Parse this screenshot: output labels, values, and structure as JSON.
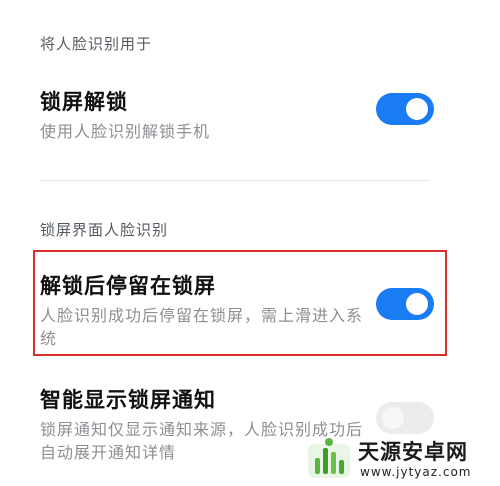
{
  "sections": {
    "face_unlock_use": "将人脸识别用于",
    "lockscreen_face": "锁屏界面人脸识别"
  },
  "rows": [
    {
      "title": "锁屏解锁",
      "subtitle": "使用人脸识别解锁手机",
      "toggle": "on"
    },
    {
      "title": "解锁后停留在锁屏",
      "subtitle": "人脸识别成功后停留在锁屏，需上滑进入系统",
      "toggle": "on"
    },
    {
      "title": "智能显示锁屏通知",
      "subtitle": "锁屏通知仅显示通知来源，人脸识别成功后自动展开通知详情",
      "toggle": "off"
    }
  ],
  "watermark": {
    "title": "天源安卓网",
    "url": "www.jytyaz.com"
  },
  "colors": {
    "accent": "#1a7cf5",
    "highlight_border": "#d9302a",
    "toggle_off": "#ececec"
  },
  "icons": {
    "watermark_logo": "green-bars-logo-icon"
  }
}
